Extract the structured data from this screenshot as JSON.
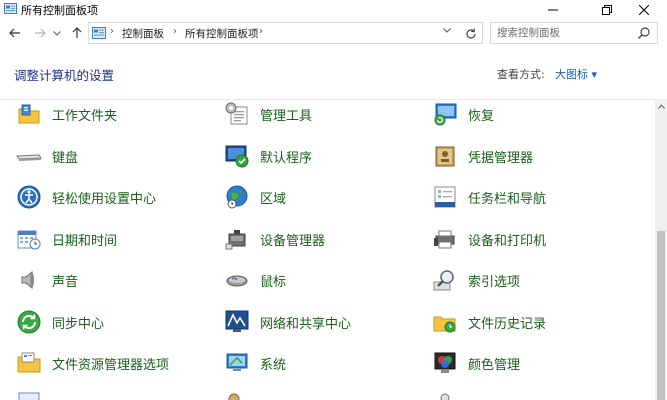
{
  "window": {
    "title": "所有控制面板项",
    "icon": "control-panel-icon",
    "min_glyph": "─",
    "max_glyph": "❐",
    "close_glyph": "✕"
  },
  "nav": {
    "back_glyph": "←",
    "forward_glyph": "→",
    "dropdown_glyph": "⌄",
    "up_glyph": "↑",
    "breadcrumb": [
      "控制面板",
      "所有控制面板项"
    ],
    "crumb_sep": "›",
    "address_dropdown_glyph": "⌄",
    "search_placeholder": "搜索控制面板"
  },
  "header": {
    "title": "调整计算机的设置",
    "view_label": "查看方式:",
    "view_value": "大图标 ▾"
  },
  "items": [
    [
      {
        "label": "工作文件夹",
        "icon": "work-folders-icon"
      },
      {
        "label": "键盘",
        "icon": "keyboard-icon"
      },
      {
        "label": "轻松使用设置中心",
        "icon": "ease-of-access-icon"
      },
      {
        "label": "日期和时间",
        "icon": "date-time-icon"
      },
      {
        "label": "声音",
        "icon": "sound-icon"
      },
      {
        "label": "同步中心",
        "icon": "sync-center-icon"
      },
      {
        "label": "文件资源管理器选项",
        "icon": "file-explorer-options-icon"
      },
      {
        "label": "",
        "icon": "partial-item-icon"
      }
    ],
    [
      {
        "label": "管理工具",
        "icon": "admin-tools-icon"
      },
      {
        "label": "默认程序",
        "icon": "default-programs-icon"
      },
      {
        "label": "区域",
        "icon": "region-globe-icon"
      },
      {
        "label": "设备管理器",
        "icon": "device-manager-icon"
      },
      {
        "label": "鼠标",
        "icon": "mouse-icon"
      },
      {
        "label": "网络和共享中心",
        "icon": "network-sharing-icon"
      },
      {
        "label": "系统",
        "icon": "system-icon"
      },
      {
        "label": "",
        "icon": "partial-item-icon"
      }
    ],
    [
      {
        "label": "恢复",
        "icon": "recovery-icon"
      },
      {
        "label": "凭据管理器",
        "icon": "credential-manager-icon"
      },
      {
        "label": "任务栏和导航",
        "icon": "taskbar-navigation-icon"
      },
      {
        "label": "设备和打印机",
        "icon": "devices-printers-icon"
      },
      {
        "label": "索引选项",
        "icon": "indexing-options-icon"
      },
      {
        "label": "文件历史记录",
        "icon": "file-history-icon"
      },
      {
        "label": "颜色管理",
        "icon": "color-management-icon"
      },
      {
        "label": "",
        "icon": "partial-item-icon"
      }
    ]
  ],
  "colors": {
    "link_green": "#1a5f1a",
    "title_blue": "#1e3287",
    "accent_blue": "#1a62b8"
  }
}
